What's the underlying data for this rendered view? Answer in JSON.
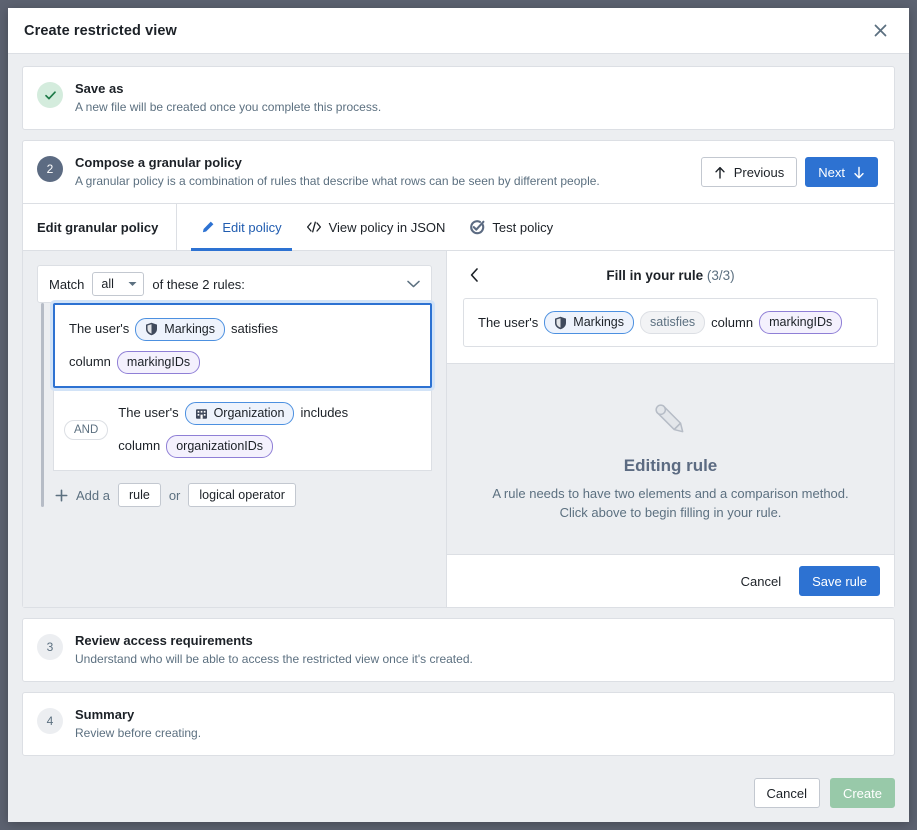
{
  "dialog": {
    "title": "Create restricted view",
    "close_icon": "close-icon"
  },
  "steps": [
    {
      "marker": "✓",
      "state": "done",
      "title": "Save as",
      "desc": "A new file will be created once you complete this process."
    },
    {
      "marker": "2",
      "state": "active",
      "title": "Compose a granular policy",
      "desc": "A granular policy is a combination of rules that describe what rows can be seen by different people."
    },
    {
      "marker": "3",
      "state": "idle",
      "title": "Review access requirements",
      "desc": "Understand who will be able to access the restricted view once it's created."
    },
    {
      "marker": "4",
      "state": "idle",
      "title": "Summary",
      "desc": "Review before creating."
    }
  ],
  "step2_actions": {
    "previous_label": "Previous",
    "previous_icon": "arrow-up-icon",
    "next_label": "Next",
    "next_icon": "arrow-down-icon"
  },
  "tabbar": {
    "heading": "Edit granular policy",
    "tabs": [
      {
        "label": "Edit policy",
        "icon": "pencil-icon",
        "active": true
      },
      {
        "label": "View policy in JSON",
        "icon": "code-icon",
        "active": false
      },
      {
        "label": "Test policy",
        "icon": "validate-icon",
        "active": false
      }
    ]
  },
  "left_pane": {
    "match_prefix": "Match",
    "match_value": "all",
    "match_suffix": "of these 2 rules:",
    "collapse_icon": "chevron-down-icon",
    "dropdown_icon": "caret-down-icon",
    "rules": [
      {
        "operator": null,
        "selected": true,
        "line1_prefix": "The user's",
        "attribute": "Markings",
        "attribute_icon": "shield-icon",
        "comparison": "satisfies",
        "line2_prefix": "column",
        "column": "markingIDs"
      },
      {
        "operator": "AND",
        "selected": false,
        "line1_prefix": "The user's",
        "attribute": "Organization",
        "attribute_icon": "building-icon",
        "comparison": "includes",
        "line2_prefix": "column",
        "column": "organizationIDs"
      }
    ],
    "add_row": {
      "plus_icon": "plus-icon",
      "prefix": "Add a",
      "rule_label": "rule",
      "joiner": "or",
      "operator_label": "logical operator"
    }
  },
  "right_pane": {
    "back_icon": "chevron-left-icon",
    "title": "Fill in your rule",
    "count": "(3/3)",
    "rule": {
      "prefix": "The user's",
      "attribute": "Markings",
      "attribute_icon": "shield-icon",
      "comparison": "satisfies",
      "mid": "column",
      "column": "markingIDs"
    },
    "empty": {
      "icon": "pencil-illustration-icon",
      "heading": "Editing rule",
      "text": "A rule needs to have two elements and a comparison method. Click above to begin filling in your rule."
    },
    "footer": {
      "cancel_label": "Cancel",
      "save_label": "Save rule"
    }
  },
  "dialog_footer": {
    "cancel_label": "Cancel",
    "create_label": "Create"
  },
  "colors": {
    "accent_blue": "#2d72d2",
    "done_green": "#1d7a47",
    "create_disabled_green": "#98c9a9",
    "chip_blue_border": "#4c90e0",
    "chip_purple_border": "#8f7fd6",
    "step_active": "#5c6b82"
  }
}
